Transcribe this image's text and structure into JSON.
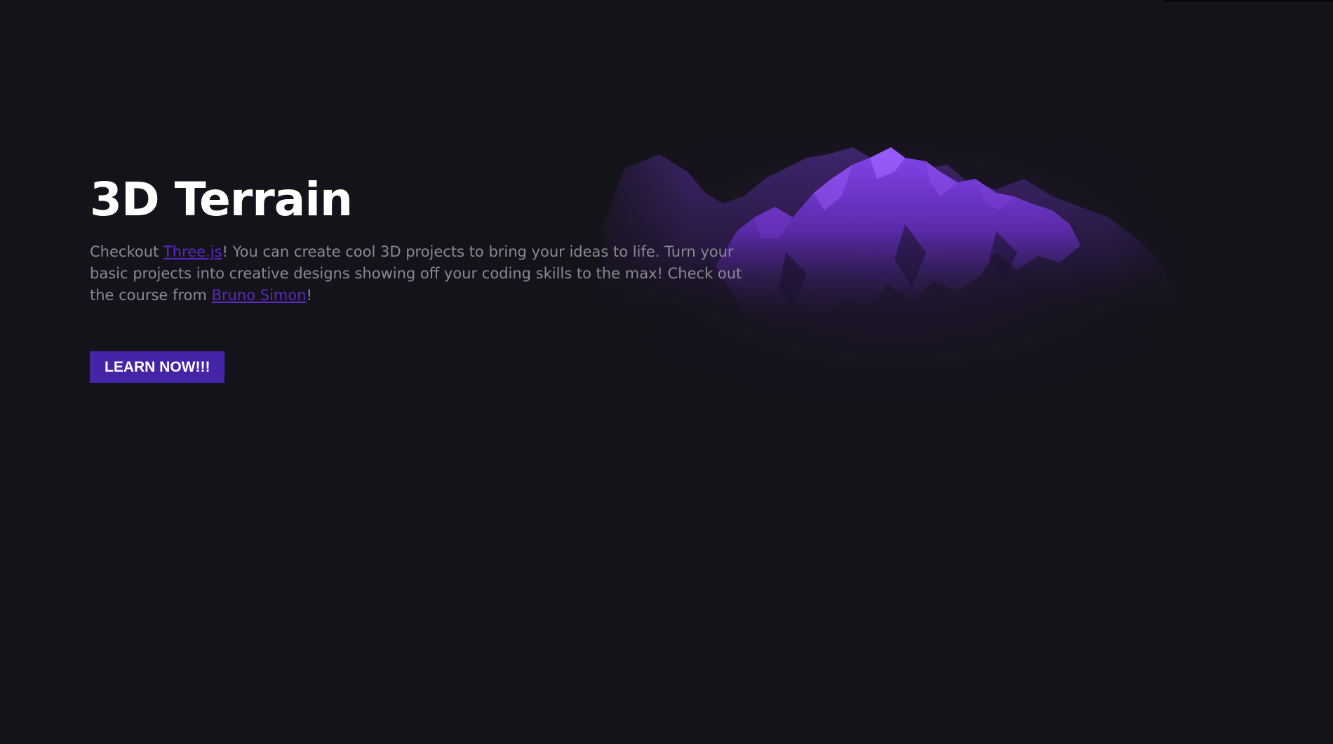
{
  "hero": {
    "title": "3D Terrain",
    "text_before_link1": "Checkout ",
    "link1_label": "Three.js",
    "text_after_link1": "! You can create cool 3D projects to bring your ideas to life. Turn your basic projects into creative designs showing off your coding skills to the max! Check out the course from ",
    "link2_label": "Bruno Simon",
    "text_end": "!",
    "button_label": "LEARN NOW!!!"
  },
  "colors": {
    "background": "#15131a",
    "title": "#ffffff",
    "body_text": "#8c8893",
    "link": "#5a28c2",
    "button": "#4624a8",
    "terrain": "#7a3fe0"
  },
  "icons": {
    "terrain": "purple-3d-mountain-terrain"
  }
}
